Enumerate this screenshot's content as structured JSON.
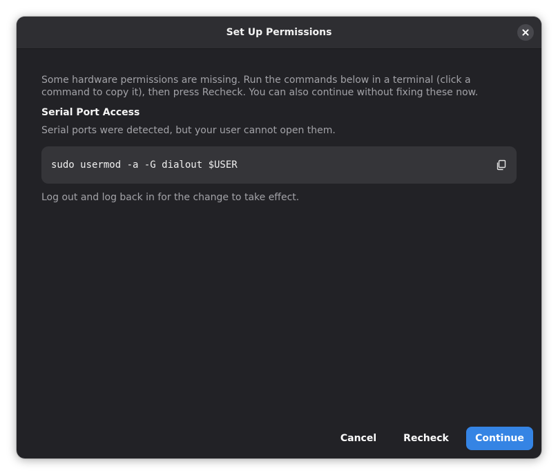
{
  "dialog": {
    "title": "Set Up Permissions",
    "close_icon": "close-icon"
  },
  "content": {
    "intro": "Some hardware permissions are missing. Run the commands below in a terminal (click a command to copy it), then press Recheck. You can also continue without fixing these now.",
    "section": {
      "heading": "Serial Port Access",
      "description": "Serial ports were detected, but your user cannot open them.",
      "command": "sudo usermod -a -G dialout $USER",
      "copy_icon": "copy-icon",
      "note": "Log out and log back in for the change to take effect."
    }
  },
  "footer": {
    "cancel_label": "Cancel",
    "recheck_label": "Recheck",
    "continue_label": "Continue"
  },
  "colors": {
    "accent": "#3584e4",
    "dialog_bg": "#222226",
    "titlebar_bg": "#2e2e32",
    "command_bg": "#353539",
    "muted_text": "#a3a3a8"
  }
}
